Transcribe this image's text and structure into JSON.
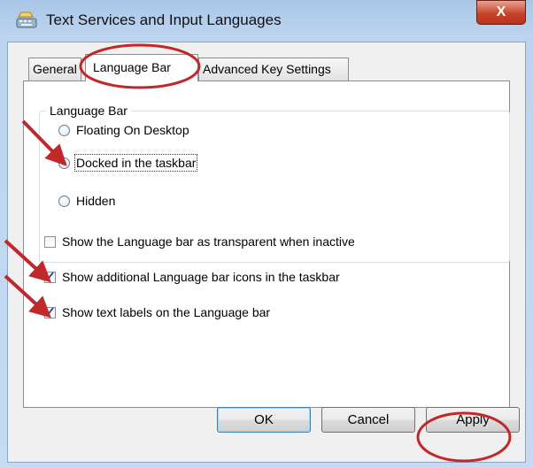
{
  "window": {
    "title": "Text Services and Input Languages",
    "close_label": "X"
  },
  "tabs": [
    {
      "label": "General"
    },
    {
      "label": "Language Bar"
    },
    {
      "label": "Advanced Key Settings"
    }
  ],
  "language_bar_group": {
    "title": "Language Bar",
    "options": [
      {
        "label": "Floating On Desktop",
        "selected": false
      },
      {
        "label": "Docked in the taskbar",
        "selected": true
      },
      {
        "label": "Hidden",
        "selected": false
      }
    ]
  },
  "checkboxes": [
    {
      "label": "Show the Language bar as transparent when inactive",
      "checked": false
    },
    {
      "label": "Show additional Language bar icons in the taskbar",
      "checked": true
    },
    {
      "label": "Show text labels on the Language bar",
      "checked": true
    }
  ],
  "buttons": {
    "ok": "OK",
    "cancel": "Cancel",
    "apply": "Apply"
  },
  "colors": {
    "annotation": "#c0282a"
  }
}
